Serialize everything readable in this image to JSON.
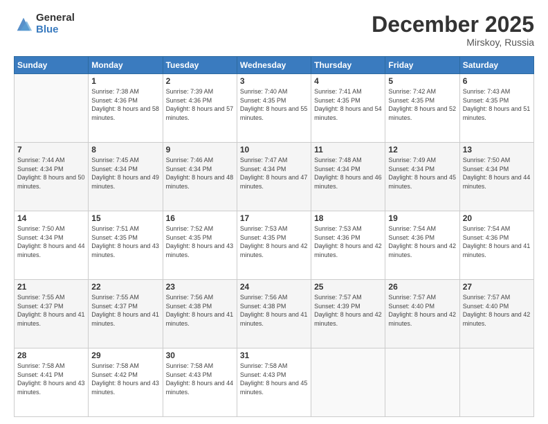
{
  "logo": {
    "general": "General",
    "blue": "Blue"
  },
  "header": {
    "month": "December 2025",
    "location": "Mirskoy, Russia"
  },
  "days_of_week": [
    "Sunday",
    "Monday",
    "Tuesday",
    "Wednesday",
    "Thursday",
    "Friday",
    "Saturday"
  ],
  "weeks": [
    [
      {
        "day": "",
        "sunrise": "",
        "sunset": "",
        "daylight": ""
      },
      {
        "day": "1",
        "sunrise": "Sunrise: 7:38 AM",
        "sunset": "Sunset: 4:36 PM",
        "daylight": "Daylight: 8 hours and 58 minutes."
      },
      {
        "day": "2",
        "sunrise": "Sunrise: 7:39 AM",
        "sunset": "Sunset: 4:36 PM",
        "daylight": "Daylight: 8 hours and 57 minutes."
      },
      {
        "day": "3",
        "sunrise": "Sunrise: 7:40 AM",
        "sunset": "Sunset: 4:35 PM",
        "daylight": "Daylight: 8 hours and 55 minutes."
      },
      {
        "day": "4",
        "sunrise": "Sunrise: 7:41 AM",
        "sunset": "Sunset: 4:35 PM",
        "daylight": "Daylight: 8 hours and 54 minutes."
      },
      {
        "day": "5",
        "sunrise": "Sunrise: 7:42 AM",
        "sunset": "Sunset: 4:35 PM",
        "daylight": "Daylight: 8 hours and 52 minutes."
      },
      {
        "day": "6",
        "sunrise": "Sunrise: 7:43 AM",
        "sunset": "Sunset: 4:35 PM",
        "daylight": "Daylight: 8 hours and 51 minutes."
      }
    ],
    [
      {
        "day": "7",
        "sunrise": "Sunrise: 7:44 AM",
        "sunset": "Sunset: 4:34 PM",
        "daylight": "Daylight: 8 hours and 50 minutes."
      },
      {
        "day": "8",
        "sunrise": "Sunrise: 7:45 AM",
        "sunset": "Sunset: 4:34 PM",
        "daylight": "Daylight: 8 hours and 49 minutes."
      },
      {
        "day": "9",
        "sunrise": "Sunrise: 7:46 AM",
        "sunset": "Sunset: 4:34 PM",
        "daylight": "Daylight: 8 hours and 48 minutes."
      },
      {
        "day": "10",
        "sunrise": "Sunrise: 7:47 AM",
        "sunset": "Sunset: 4:34 PM",
        "daylight": "Daylight: 8 hours and 47 minutes."
      },
      {
        "day": "11",
        "sunrise": "Sunrise: 7:48 AM",
        "sunset": "Sunset: 4:34 PM",
        "daylight": "Daylight: 8 hours and 46 minutes."
      },
      {
        "day": "12",
        "sunrise": "Sunrise: 7:49 AM",
        "sunset": "Sunset: 4:34 PM",
        "daylight": "Daylight: 8 hours and 45 minutes."
      },
      {
        "day": "13",
        "sunrise": "Sunrise: 7:50 AM",
        "sunset": "Sunset: 4:34 PM",
        "daylight": "Daylight: 8 hours and 44 minutes."
      }
    ],
    [
      {
        "day": "14",
        "sunrise": "Sunrise: 7:50 AM",
        "sunset": "Sunset: 4:34 PM",
        "daylight": "Daylight: 8 hours and 44 minutes."
      },
      {
        "day": "15",
        "sunrise": "Sunrise: 7:51 AM",
        "sunset": "Sunset: 4:35 PM",
        "daylight": "Daylight: 8 hours and 43 minutes."
      },
      {
        "day": "16",
        "sunrise": "Sunrise: 7:52 AM",
        "sunset": "Sunset: 4:35 PM",
        "daylight": "Daylight: 8 hours and 43 minutes."
      },
      {
        "day": "17",
        "sunrise": "Sunrise: 7:53 AM",
        "sunset": "Sunset: 4:35 PM",
        "daylight": "Daylight: 8 hours and 42 minutes."
      },
      {
        "day": "18",
        "sunrise": "Sunrise: 7:53 AM",
        "sunset": "Sunset: 4:36 PM",
        "daylight": "Daylight: 8 hours and 42 minutes."
      },
      {
        "day": "19",
        "sunrise": "Sunrise: 7:54 AM",
        "sunset": "Sunset: 4:36 PM",
        "daylight": "Daylight: 8 hours and 42 minutes."
      },
      {
        "day": "20",
        "sunrise": "Sunrise: 7:54 AM",
        "sunset": "Sunset: 4:36 PM",
        "daylight": "Daylight: 8 hours and 41 minutes."
      }
    ],
    [
      {
        "day": "21",
        "sunrise": "Sunrise: 7:55 AM",
        "sunset": "Sunset: 4:37 PM",
        "daylight": "Daylight: 8 hours and 41 minutes."
      },
      {
        "day": "22",
        "sunrise": "Sunrise: 7:55 AM",
        "sunset": "Sunset: 4:37 PM",
        "daylight": "Daylight: 8 hours and 41 minutes."
      },
      {
        "day": "23",
        "sunrise": "Sunrise: 7:56 AM",
        "sunset": "Sunset: 4:38 PM",
        "daylight": "Daylight: 8 hours and 41 minutes."
      },
      {
        "day": "24",
        "sunrise": "Sunrise: 7:56 AM",
        "sunset": "Sunset: 4:38 PM",
        "daylight": "Daylight: 8 hours and 41 minutes."
      },
      {
        "day": "25",
        "sunrise": "Sunrise: 7:57 AM",
        "sunset": "Sunset: 4:39 PM",
        "daylight": "Daylight: 8 hours and 42 minutes."
      },
      {
        "day": "26",
        "sunrise": "Sunrise: 7:57 AM",
        "sunset": "Sunset: 4:40 PM",
        "daylight": "Daylight: 8 hours and 42 minutes."
      },
      {
        "day": "27",
        "sunrise": "Sunrise: 7:57 AM",
        "sunset": "Sunset: 4:40 PM",
        "daylight": "Daylight: 8 hours and 42 minutes."
      }
    ],
    [
      {
        "day": "28",
        "sunrise": "Sunrise: 7:58 AM",
        "sunset": "Sunset: 4:41 PM",
        "daylight": "Daylight: 8 hours and 43 minutes."
      },
      {
        "day": "29",
        "sunrise": "Sunrise: 7:58 AM",
        "sunset": "Sunset: 4:42 PM",
        "daylight": "Daylight: 8 hours and 43 minutes."
      },
      {
        "day": "30",
        "sunrise": "Sunrise: 7:58 AM",
        "sunset": "Sunset: 4:43 PM",
        "daylight": "Daylight: 8 hours and 44 minutes."
      },
      {
        "day": "31",
        "sunrise": "Sunrise: 7:58 AM",
        "sunset": "Sunset: 4:43 PM",
        "daylight": "Daylight: 8 hours and 45 minutes."
      },
      {
        "day": "",
        "sunrise": "",
        "sunset": "",
        "daylight": ""
      },
      {
        "day": "",
        "sunrise": "",
        "sunset": "",
        "daylight": ""
      },
      {
        "day": "",
        "sunrise": "",
        "sunset": "",
        "daylight": ""
      }
    ]
  ]
}
